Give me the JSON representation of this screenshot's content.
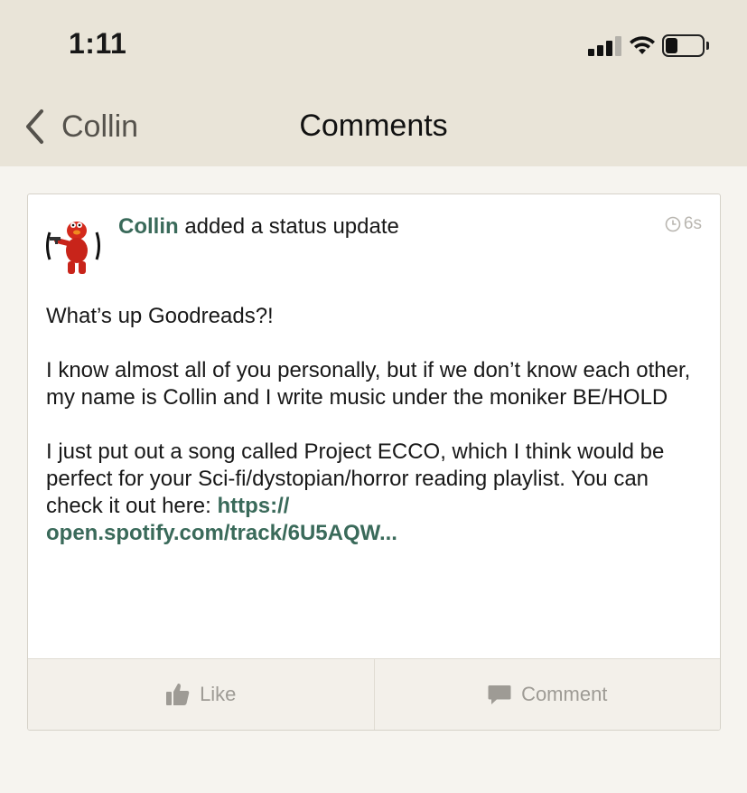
{
  "status_bar": {
    "time": "1:11"
  },
  "nav": {
    "back_label": "Collin",
    "title": "Comments"
  },
  "post": {
    "author": "Collin",
    "action_text": " added a status update",
    "timestamp": "6s",
    "paragraphs": [
      "What’s up Goodreads?!",
      "I know almost all of you personally, but if we don’t know each other, my name is Collin and I write music under the moniker BE/HOLD"
    ],
    "last_paragraph_text": "I just put out a song called Project ECCO, which I think would be perfect for your Sci-fi/dystopian/horror reading playlist. You can check it out here: ",
    "link_text": "https://\nopen.spotify.com/track/6U5AQW..."
  },
  "actions": {
    "like_label": "Like",
    "comment_label": "Comment"
  },
  "colors": {
    "link": "#3a6a5a",
    "header_bg": "#e9e4d8",
    "page_bg": "#f6f4ef",
    "muted": "#9e9b95"
  },
  "icons": [
    "chevron-left-icon",
    "cellular-signal-icon",
    "wifi-icon",
    "battery-icon",
    "clock-icon",
    "thumbs-up-icon",
    "speech-bubble-icon"
  ]
}
